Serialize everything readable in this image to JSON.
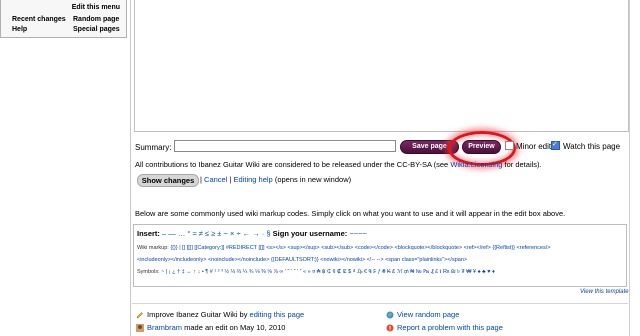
{
  "leftnav": {
    "edit_menu": "Edit this menu",
    "items": [
      "Recent changes",
      "Random page",
      "Help",
      "Special pages"
    ]
  },
  "summary": {
    "label": "Summary:",
    "value": ""
  },
  "buttons": {
    "save": "Save page",
    "preview": "Preview",
    "show_changes": "Show changes"
  },
  "checkboxes": {
    "minor": "Minor edit",
    "watch": "Watch this page"
  },
  "contrib": {
    "text": "All contributions to Ibanez Guitar Wiki are considered to be released under the CC-BY-SA (see ",
    "link": "Wikia:Licensing",
    "tail": " for details)."
  },
  "after_show": {
    "sep1": " | ",
    "cancel": "Cancel",
    "sep2": " | ",
    "help": "Editing help",
    "note": " (opens in new window)"
  },
  "below_text": "Below are some commonly used wiki markup codes. Simply click on what you want to use and it will appear in the edit box above.",
  "insert": {
    "label": "Insert:",
    "chars": " – — … ° ≈ ≠ ≤ ≥ ± − × ÷ ← → · § ",
    "sign": "Sign your username:",
    "sig": " ~~~~"
  },
  "wiki_markup": {
    "label": "Wiki markup:",
    "line1": "{{}}  |  []  [[]]  [[Category:]]  #REDIRECT [[]]  <s></s>  <sup></sup>  <sub></sub>  <code></code>  <blockquote></blockquote>  <ref></ref>  {{Reflist}}  <references/>",
    "line2": "<includeonly></includeonly>  <noinclude></noinclude>  {{DEFAULTSORT:}}  <nowiki></nowiki>  <!-- -->  <span class=\"plainlinks\"></span>"
  },
  "symbols": {
    "label": "Symbols:",
    "chars": " ~ | ¡ ¿ † ‡ ↔ ↑ ↓ • ¶  # ¹ ² ³ ½ ⅓ ⅔ ¼ ¾ ⅛ ⅜ ⅝ ⅞ ∞  ' \" ‘ “ ’ ” « »  ¤ ₳ ฿ ₵ ¢ ₡ ₢ $ ₫ ₯ € ₠ ₣ ƒ ₴ ₭ ₤ ℳ ₥ ₦ № ₧ ₰ £ ៛ ₨ ₪ ৳ ₮ ₩ ¥  ♠ ♣ ♥ ♦"
  },
  "view_template": "View this template",
  "footer": {
    "improve_pre": "Improve Ibanez Guitar Wiki by ",
    "improve_link": "editing this page",
    "user": "Brambram",
    "user_action": " made an edit on May 10, 2010",
    "view_random": "View random page",
    "report": "Report a problem with this page"
  },
  "colors": {
    "accent": "#5a1847",
    "highlight_circle": "#e0151b",
    "link": "#0645ad"
  }
}
